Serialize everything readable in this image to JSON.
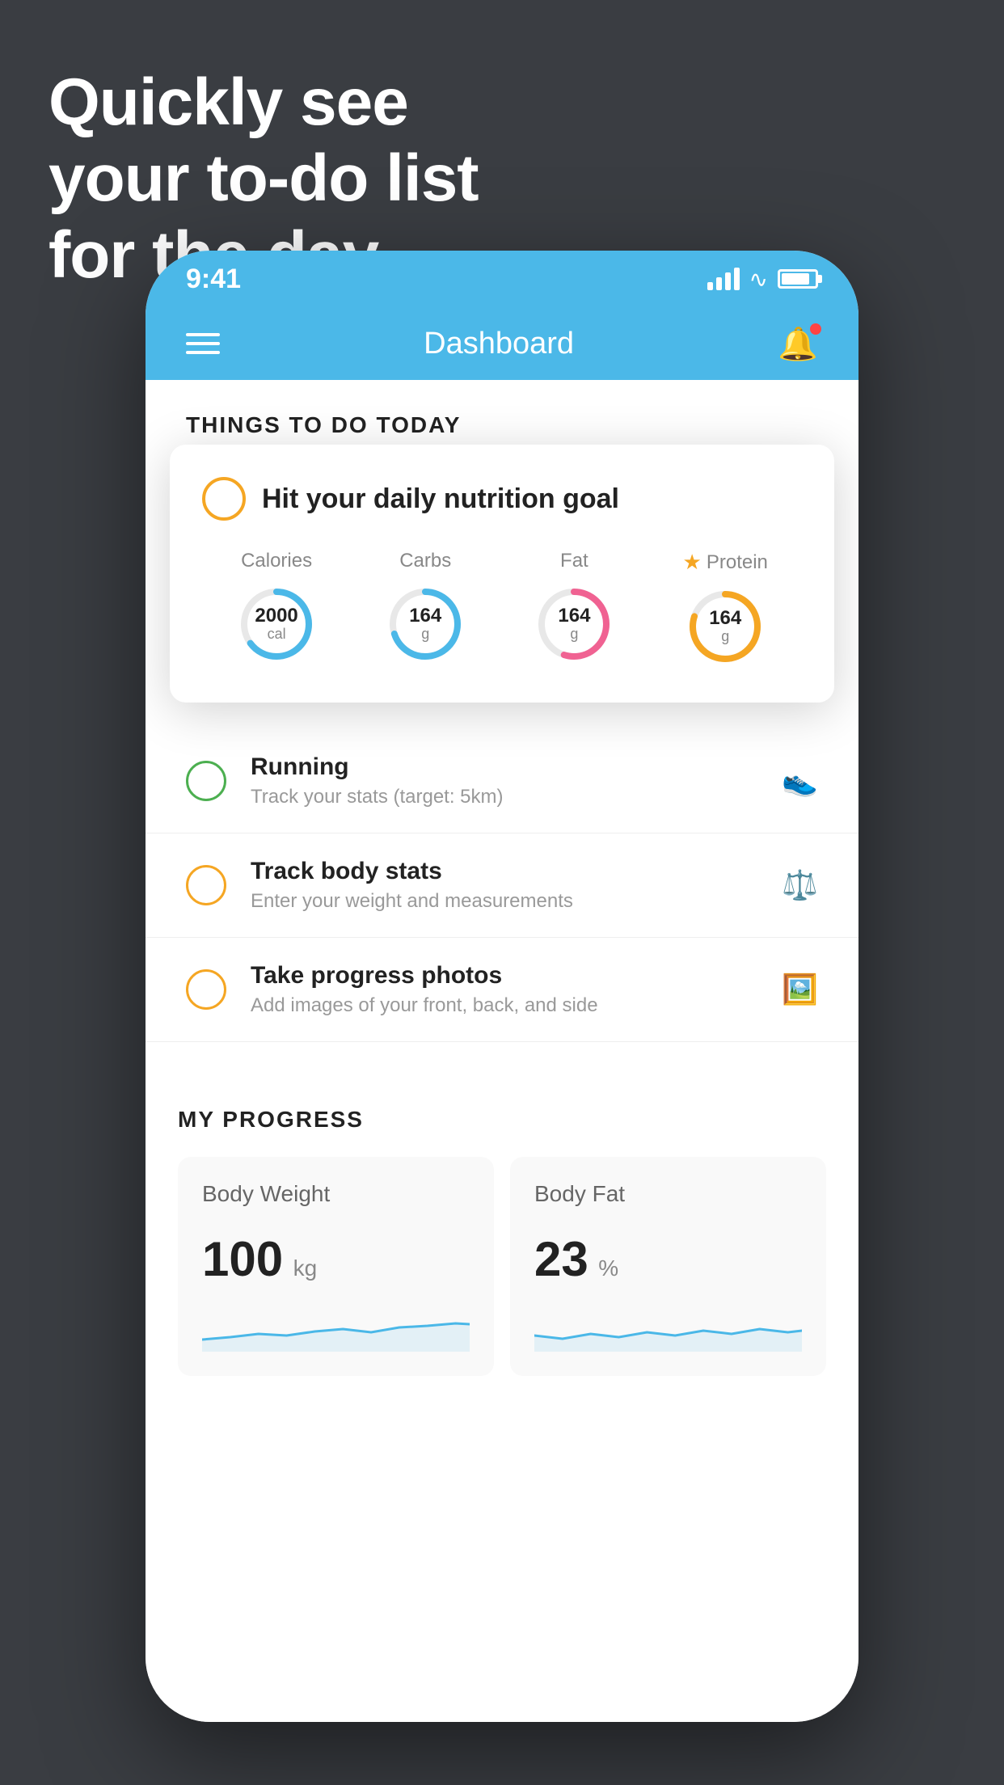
{
  "headline": {
    "line1": "Quickly see",
    "line2": "your to-do list",
    "line3": "for the day."
  },
  "status_bar": {
    "time": "9:41",
    "signal_label": "signal",
    "wifi_label": "wifi",
    "battery_label": "battery"
  },
  "nav": {
    "title": "Dashboard",
    "menu_label": "menu",
    "bell_label": "notifications"
  },
  "section_today": {
    "header": "THINGS TO DO TODAY"
  },
  "nutrition_card": {
    "title": "Hit your daily nutrition goal",
    "macros": [
      {
        "label": "Calories",
        "value": "2000",
        "unit": "cal",
        "color": "#4bb8e8",
        "pct": 65,
        "star": false
      },
      {
        "label": "Carbs",
        "value": "164",
        "unit": "g",
        "color": "#4bb8e8",
        "pct": 70,
        "star": false
      },
      {
        "label": "Fat",
        "value": "164",
        "unit": "g",
        "color": "#f06292",
        "pct": 55,
        "star": false
      },
      {
        "label": "Protein",
        "value": "164",
        "unit": "g",
        "color": "#f5a623",
        "pct": 80,
        "star": true
      }
    ]
  },
  "todo_items": [
    {
      "circle_class": "green",
      "title": "Running",
      "subtitle": "Track your stats (target: 5km)",
      "icon": "shoe"
    },
    {
      "circle_class": "yellow",
      "title": "Track body stats",
      "subtitle": "Enter your weight and measurements",
      "icon": "scale"
    },
    {
      "circle_class": "yellow",
      "title": "Take progress photos",
      "subtitle": "Add images of your front, back, and side",
      "icon": "photo"
    }
  ],
  "progress_section": {
    "header": "MY PROGRESS",
    "cards": [
      {
        "label": "Body Weight",
        "value": "100",
        "unit": "kg"
      },
      {
        "label": "Body Fat",
        "value": "23",
        "unit": "%"
      }
    ]
  }
}
